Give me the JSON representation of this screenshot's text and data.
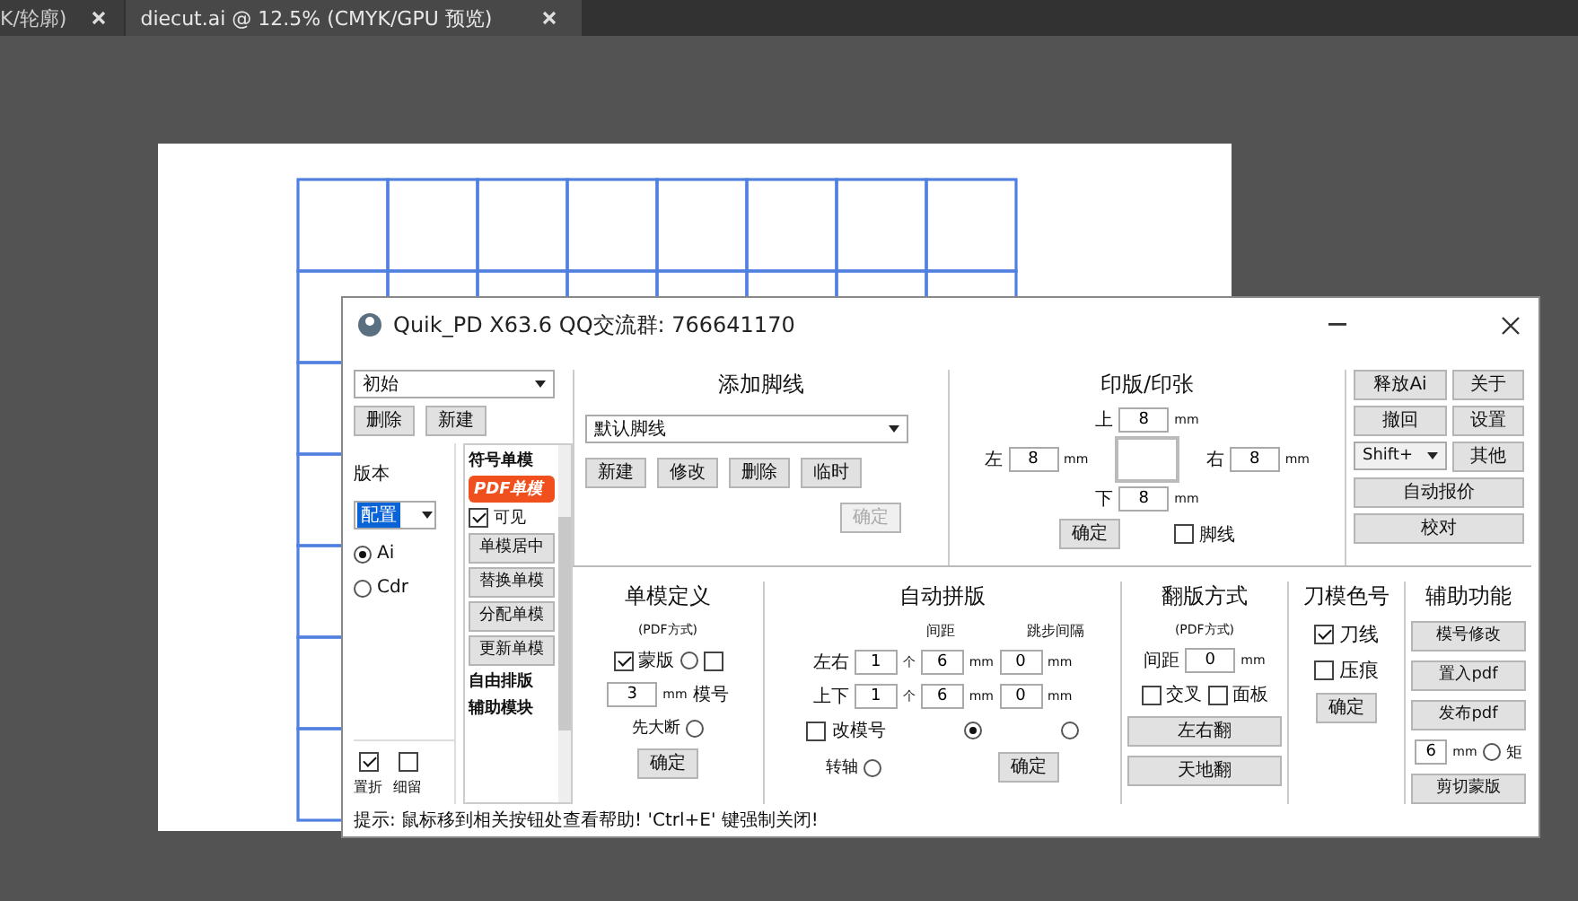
{
  "tabs": [
    {
      "label": "K/轮廓)",
      "selected": false
    },
    {
      "label": "diecut.ai @ 12.5% (CMYK/GPU 预览)",
      "selected": true
    }
  ],
  "dialog": {
    "title": "Quik_PD X63.6  QQ交流群: 766641170",
    "preset": {
      "value": "初始",
      "buttons": [
        "删除",
        "新建"
      ]
    },
    "version": {
      "label": "版本",
      "value": "配置",
      "options": [
        {
          "label": "Ai",
          "selected": true
        },
        {
          "label": "Cdr",
          "selected": false
        }
      ],
      "checks": [
        {
          "label": "置折",
          "checked": true
        },
        {
          "label": "细留",
          "checked": false
        }
      ]
    },
    "module_list": {
      "title": "符号单模",
      "items": [
        {
          "label": "PDF单模",
          "selected": true
        }
      ],
      "visible": {
        "label": "可见",
        "checked": true
      },
      "buttons": [
        "单模居中",
        "替换单模",
        "分配单模",
        "更新单模"
      ],
      "footer": [
        "自由排版",
        "辅助模块"
      ]
    },
    "footline": {
      "title": "添加脚线",
      "value": "默认脚线",
      "buttons": [
        "新建",
        "修改",
        "删除",
        "临时"
      ],
      "confirm": {
        "label": "确定",
        "disabled": true
      }
    },
    "sheet": {
      "title": "印版/印张",
      "fields": [
        {
          "label": "上",
          "value": "8",
          "unit": "mm"
        },
        {
          "label": "左",
          "value": "8",
          "unit": "mm"
        },
        {
          "label": "右",
          "value": "8",
          "unit": "mm"
        },
        {
          "label": "下",
          "value": "8",
          "unit": "mm"
        }
      ],
      "check": {
        "label": "脚线",
        "checked": false
      },
      "confirm": "确定"
    },
    "tools": {
      "buttons": [
        "释放Ai",
        "关于",
        "撤回",
        "设置"
      ],
      "shift": "Shift+",
      "other": "其他",
      "wide": [
        "自动报价",
        "校对"
      ]
    },
    "single": {
      "title": "单模定义",
      "subtitle": "(PDF方式)",
      "mask": {
        "label": "蒙版",
        "checked": true,
        "radio": false
      },
      "number": {
        "label": "模号",
        "checked": false
      },
      "size": {
        "value": "3",
        "unit": "mm"
      },
      "first": {
        "label": "先大断",
        "selected": false
      },
      "confirm": "确定"
    },
    "auto": {
      "title": "自动拼版",
      "headers": [
        "间距",
        "跳步间隔"
      ],
      "rows": [
        {
          "label": "左右",
          "count": "1",
          "count_unit": "个",
          "gap": "6",
          "gap_unit": "mm",
          "skip": "0",
          "skip_unit": "mm"
        },
        {
          "label": "上下",
          "count": "1",
          "count_unit": "个",
          "gap": "6",
          "gap_unit": "mm",
          "skip": "0",
          "skip_unit": "mm"
        }
      ],
      "renumber": {
        "label": "改模号",
        "checked": false
      },
      "radios": [
        {
          "selected": true
        },
        {
          "selected": false
        }
      ],
      "rotate": {
        "label": "转轴",
        "selected": false
      },
      "confirm": "确定"
    },
    "flip": {
      "title": "翻版方式",
      "subtitle": "(PDF方式)",
      "gap": {
        "label": "间距",
        "value": "0",
        "unit": "mm"
      },
      "checks": [
        {
          "label": "交叉",
          "checked": false
        },
        {
          "label": "面板",
          "checked": false
        }
      ],
      "buttons": [
        "左右翻",
        "天地翻"
      ]
    },
    "knife": {
      "title": "刀模色号",
      "checks": [
        {
          "label": "刀线",
          "checked": true
        },
        {
          "label": "压痕",
          "checked": false
        }
      ],
      "confirm": "确定"
    },
    "assist": {
      "title": "辅助功能",
      "buttons": [
        "模号修改",
        "置入pdf",
        "发布pdf"
      ],
      "field": {
        "value": "6",
        "unit": "mm"
      },
      "radio": {
        "label": "矩",
        "selected": false
      },
      "last": "剪切蒙版"
    },
    "status": "提示: 鼠标移到相关按钮处查看帮助!  'Ctrl+E' 键强制关闭!"
  }
}
